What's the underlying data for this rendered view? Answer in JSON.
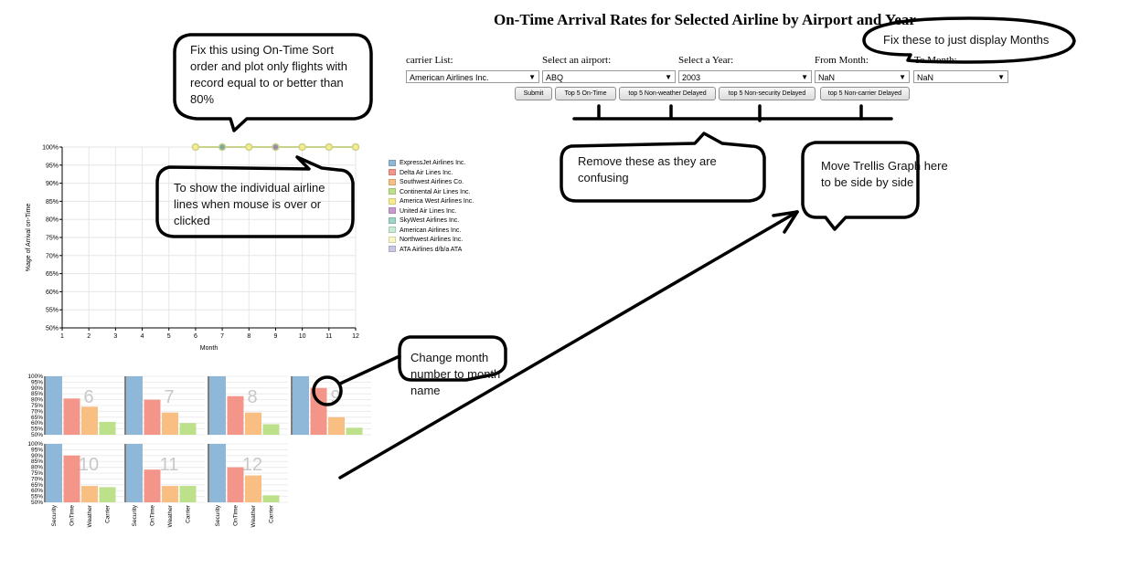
{
  "title": "On-Time Arrival Rates for Selected Airline by Airport and Year",
  "controls": {
    "carrier_label": "carrier List:",
    "carrier_value": "American Airlines Inc.",
    "airport_label": "Select an airport:",
    "airport_value": "ABQ",
    "year_label": "Select a Year:",
    "year_value": "2003",
    "from_month_label": "From Month:",
    "from_month_value": "NaN",
    "to_month_label": "To Month:",
    "to_month_value": "NaN"
  },
  "buttons": {
    "submit": "Submit",
    "top5_ontime": "Top 5 On-Time",
    "top5_weather": "top 5 Non-weather Delayed",
    "top5_security": "top 5 Non-security Delayed",
    "top5_carrier": "top 5 Non-carrier Delayed"
  },
  "annotations": {
    "sort_note": "Fix this using On-Time Sort order and plot only flights with record equal to or better than 80%",
    "months_note": "Fix these to just display Months",
    "lines_note": "To show the individual airline lines when mouse is over or clicked",
    "remove_note": "Remove these as they are confusing",
    "trellis_note": "Move Trellis Graph here to be side by side",
    "month_name_note": "Change month number to month name"
  },
  "legend": [
    {
      "label": "ExpressJet Airlines Inc.",
      "color": "#8fb8d8"
    },
    {
      "label": "Delta Air Lines Inc.",
      "color": "#f4958a"
    },
    {
      "label": "Southwest Airlines Co.",
      "color": "#f8be82"
    },
    {
      "label": "Continental Air Lines Inc.",
      "color": "#bde08a"
    },
    {
      "label": "America West Airlines Inc.",
      "color": "#f7ec8a"
    },
    {
      "label": "United Air Lines Inc.",
      "color": "#c99ad1"
    },
    {
      "label": "SkyWest Airlines Inc.",
      "color": "#9fd4c8"
    },
    {
      "label": "American Airlines Inc.",
      "color": "#c9ecd4"
    },
    {
      "label": "Northwest Airlines Inc.",
      "color": "#fbf7c4"
    },
    {
      "label": "ATA Airlines d/b/a ATA",
      "color": "#c8c8e6"
    }
  ],
  "chart_data": [
    {
      "type": "line",
      "xlabel": "Month",
      "ylabel": "%age of Arrival on-Time",
      "x_ticks": [
        "1",
        "2",
        "3",
        "4",
        "5",
        "6",
        "7",
        "8",
        "9",
        "10",
        "11",
        "12"
      ],
      "y_ticks": [
        "50%",
        "55%",
        "60%",
        "65%",
        "70%",
        "75%",
        "80%",
        "85%",
        "90%",
        "95%",
        "100%"
      ],
      "xlim": [
        1,
        12
      ],
      "ylim": [
        50,
        100
      ],
      "grid": true,
      "legend_position": "right",
      "series": [
        {
          "x": [
            6,
            7,
            8,
            9,
            10,
            11,
            12
          ],
          "y": [
            100,
            100,
            100,
            100,
            100,
            100,
            100
          ],
          "color": "#c9d28a"
        }
      ],
      "point_colors": [
        "#f7ec8a",
        "#7fa7a0",
        "#f7ec8a",
        "#9a8aa8",
        "#f7ec8a",
        "#f7ec8a",
        "#f7ec8a"
      ]
    },
    {
      "type": "bar",
      "trellis": true,
      "categories": [
        "Security",
        "OnTime",
        "Weather",
        "Carrier"
      ],
      "y_ticks": [
        "50%",
        "55%",
        "60%",
        "65%",
        "70%",
        "75%",
        "80%",
        "85%",
        "90%",
        "95%",
        "100%"
      ],
      "ylim": [
        50,
        100
      ],
      "colors": [
        "#8fb8d8",
        "#f4958a",
        "#f8be82",
        "#bde08a"
      ],
      "panels": [
        {
          "month": "6",
          "values": [
            100,
            81,
            74,
            61
          ]
        },
        {
          "month": "7",
          "values": [
            100,
            80,
            69,
            60
          ]
        },
        {
          "month": "8",
          "values": [
            100,
            83,
            69,
            59
          ]
        },
        {
          "month": "9",
          "values": [
            100,
            90,
            65,
            56
          ]
        },
        {
          "month": "10",
          "values": [
            100,
            90,
            64,
            63
          ]
        },
        {
          "month": "11",
          "values": [
            100,
            78,
            64,
            64
          ]
        },
        {
          "month": "12",
          "values": [
            100,
            80,
            73,
            56
          ]
        }
      ]
    }
  ]
}
